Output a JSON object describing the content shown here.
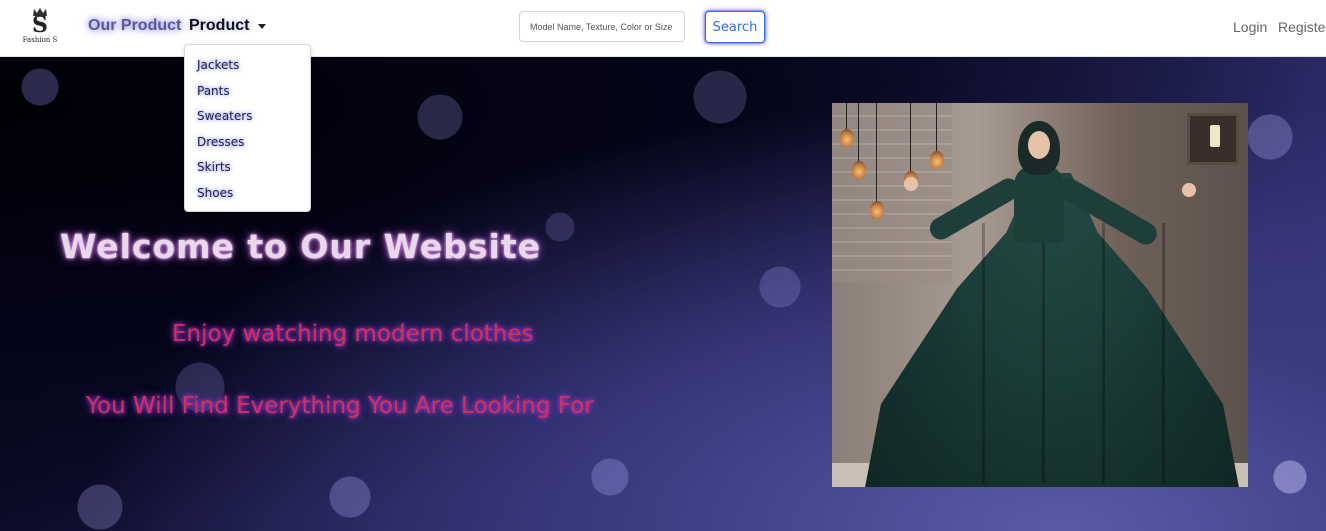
{
  "brand": {
    "logo_symbol": "S",
    "logo_text": "Fashion S",
    "crown_icon": "crown-icon"
  },
  "nav": {
    "our_product_label": "Our Product",
    "product_label": "Product",
    "product_menu": [
      "Jackets",
      "Pants",
      "Sweaters",
      "Dresses",
      "Skirts",
      "Shoes"
    ],
    "login_label": "Login",
    "register_label": "Register"
  },
  "search": {
    "placeholder": "Model Name, Texture, Color or Size",
    "value": "",
    "button_label": "Search"
  },
  "hero": {
    "title": "Welcome to Our Website",
    "subtitle_1": "Enjoy watching modern clothes",
    "subtitle_2": "You Will Find Everything You Are Looking For"
  },
  "colors": {
    "search_accent": "#2f6fe0",
    "title_glow": "#c87fd6",
    "subtitle_text": "#d0305c",
    "hero_background": "#1e1e4e"
  }
}
